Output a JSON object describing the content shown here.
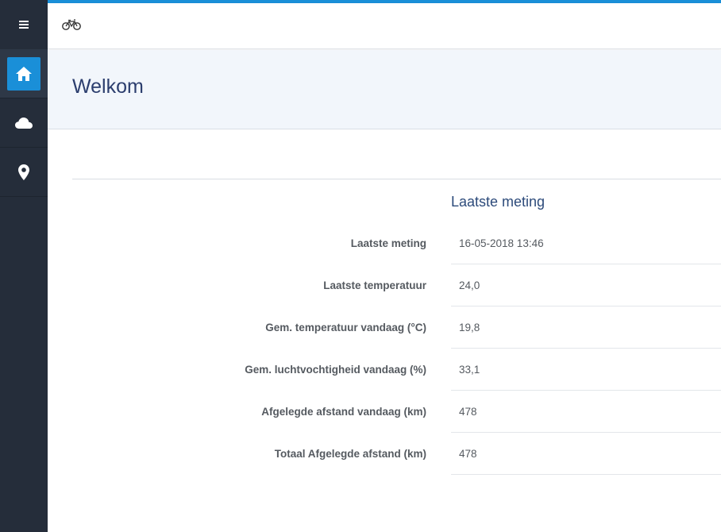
{
  "sidebar": {
    "items": [
      {
        "name": "menu",
        "icon": "hamburger-icon"
      },
      {
        "name": "home",
        "icon": "home-icon",
        "active": true
      },
      {
        "name": "weather",
        "icon": "cloud-icon"
      },
      {
        "name": "location",
        "icon": "map-pin-icon"
      }
    ]
  },
  "topbar": {
    "logo_icon": "bicycle-icon"
  },
  "banner": {
    "title": "Welkom"
  },
  "section": {
    "title": "Laatste meting",
    "rows": [
      {
        "label": "Laatste meting",
        "value": "16-05-2018 13:46"
      },
      {
        "label": "Laatste temperatuur",
        "value": "24,0"
      },
      {
        "label": "Gem. temperatuur vandaag (°C)",
        "value": "19,8"
      },
      {
        "label": "Gem. luchtvochtigheid vandaag (%)",
        "value": "33,1"
      },
      {
        "label": "Afgelegde afstand vandaag (km)",
        "value": "478"
      },
      {
        "label": "Totaal Afgelegde afstand (km)",
        "value": "478"
      }
    ]
  },
  "colors": {
    "accent": "#1a8fd8",
    "sidebar": "#252d3a",
    "title": "#2c3e6e"
  }
}
